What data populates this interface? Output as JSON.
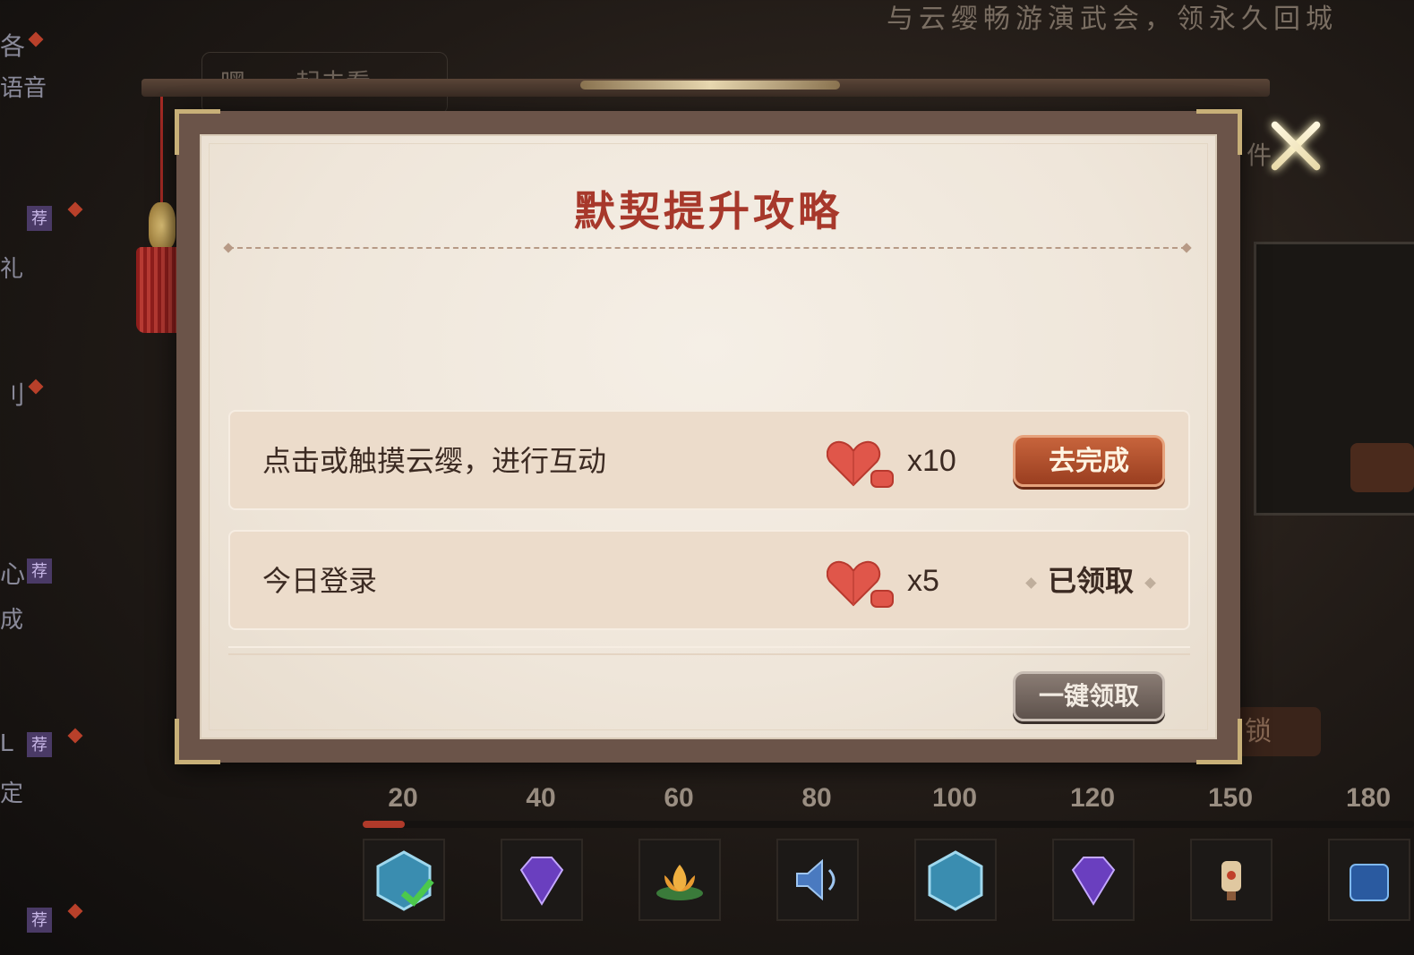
{
  "background": {
    "top_banner": "与云缨畅游演武会，领永久回城",
    "speech_bubble": "嘿，一起去看",
    "left_rail": [
      {
        "text": "各",
        "sub": "语音"
      },
      {
        "text": "",
        "sub": "礼",
        "tag": "荐"
      },
      {
        "text": "刂",
        "sub": ""
      },
      {
        "text": "心",
        "sub": "成",
        "tag": "荐"
      },
      {
        "text": "L",
        "sub": "定",
        "tag": "荐"
      },
      {
        "text": "",
        "sub": "",
        "tag": "荐"
      }
    ],
    "side_text": "件",
    "lock_button": "锁",
    "levels": [
      "20",
      "40",
      "60",
      "80",
      "100",
      "120",
      "150",
      "180"
    ],
    "progress_fraction": 0.04,
    "reward_icons": [
      "hexagon-gem-checked-icon",
      "purple-diamond-icon",
      "lotus-icon",
      "speaker-icon",
      "hexagon-gem-icon",
      "purple-diamond-icon",
      "lantern-icon",
      "blue-crystal-icon"
    ]
  },
  "dialog": {
    "title": "默契提升攻略",
    "tasks": [
      {
        "label": "点击或触摸云缨，进行互动",
        "reward_icon": "heart-icon",
        "quantity": "x10",
        "action": "去完成",
        "status": "go"
      },
      {
        "label": "今日登录",
        "reward_icon": "heart-icon",
        "quantity": "x5",
        "action": "已领取",
        "status": "claimed"
      }
    ],
    "claim_all_label": "一键领取",
    "close_icon": "close-icon"
  },
  "colors": {
    "title": "#a7382b",
    "go_button": "#b24d2c",
    "heart": "#e0564a"
  }
}
